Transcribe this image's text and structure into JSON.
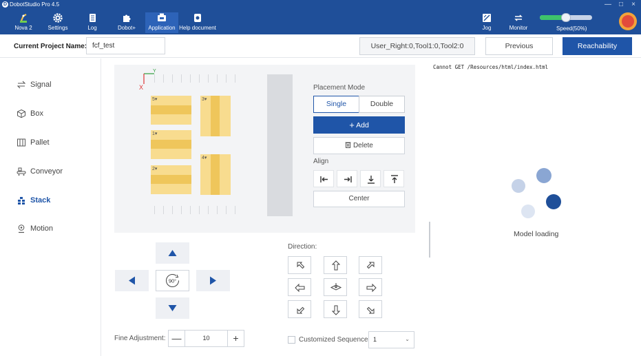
{
  "window": {
    "title": "DobotStudio Pro 4.5",
    "minimize": "—",
    "maximize": "□",
    "close": "×"
  },
  "toolbar": {
    "items": [
      {
        "label": "Nova 2",
        "icon": "robot-arm-icon"
      },
      {
        "label": "Settings",
        "icon": "gear-icon"
      },
      {
        "label": "Log",
        "icon": "log-icon"
      },
      {
        "label": "Dobot+",
        "icon": "puzzle-icon"
      },
      {
        "label": "Application",
        "icon": "application-icon"
      },
      {
        "label": "Help document",
        "icon": "help-document-icon"
      }
    ],
    "right_items": [
      {
        "label": "Jog",
        "icon": "jog-icon"
      },
      {
        "label": "Monitor",
        "icon": "monitor-icon"
      }
    ],
    "speed": {
      "label": "Speed(50%)",
      "value": 50
    },
    "colors": {
      "bar": "#1f4f99",
      "active": "#2d63b8"
    }
  },
  "project": {
    "label": "Current Project Name:",
    "name": "fcf_test",
    "coords": "User_Right:0,Tool1:0,Tool2:0",
    "previous": "Previous",
    "reachability": "Reachability"
  },
  "sidebar": {
    "items": [
      {
        "label": "Signal",
        "icon": "signal-icon",
        "active": false
      },
      {
        "label": "Box",
        "icon": "box-icon",
        "active": false
      },
      {
        "label": "Pallet",
        "icon": "pallet-icon",
        "active": false
      },
      {
        "label": "Conveyor",
        "icon": "conveyor-icon",
        "active": false
      },
      {
        "label": "Stack",
        "icon": "stack-icon",
        "active": true
      },
      {
        "label": "Motion",
        "icon": "motion-icon",
        "active": false
      }
    ]
  },
  "canvas": {
    "axis_x": "X",
    "axis_y": "Y",
    "boxes": [
      {
        "number": "5",
        "orientation": "horizontal"
      },
      {
        "number": "3",
        "orientation": "vertical"
      },
      {
        "number": "1",
        "orientation": "horizontal"
      },
      {
        "number": "4",
        "orientation": "vertical"
      },
      {
        "number": "2",
        "orientation": "horizontal"
      }
    ]
  },
  "placement": {
    "label": "Placement Mode",
    "single": "Single",
    "double": "Double",
    "selected": "Single",
    "add": "Add",
    "delete": "Delete",
    "align_label": "Align",
    "center": "Center"
  },
  "direction": {
    "label": "Direction:"
  },
  "fine": {
    "label": "Fine Adjustment:",
    "value": "10",
    "minus": "—",
    "plus": "+"
  },
  "sequence": {
    "label": "Customized Sequence:",
    "value": "1",
    "checked": false
  },
  "preview": {
    "error": "Cannot GET /Resources/html/index.html",
    "loading": "Model loading"
  },
  "rotate": {
    "label": "90°"
  }
}
